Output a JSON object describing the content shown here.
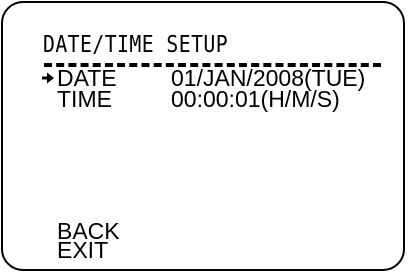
{
  "title": "DATE/TIME SETUP",
  "rows": [
    {
      "label": "DATE",
      "value": "01/JAN/2008(TUE)",
      "selected": true
    },
    {
      "label": "TIME",
      "value": "00:00:01(H/M/S)",
      "selected": false
    }
  ],
  "actions": {
    "back": "BACK",
    "exit": "EXIT"
  },
  "icons": {
    "cursor": "arrow-right-icon"
  },
  "colors": {
    "foreground": "#000000",
    "background": "#ffffff"
  }
}
